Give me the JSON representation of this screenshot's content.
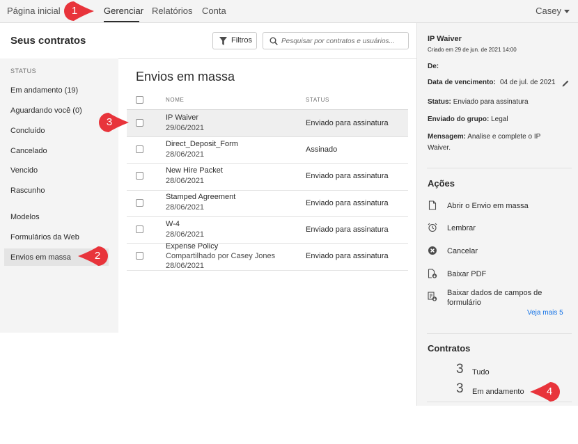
{
  "topnav": {
    "tabs": [
      "Página inicial",
      "Gerenciar",
      "Relatórios",
      "Conta"
    ],
    "active_tab": "Gerenciar",
    "user": "Casey"
  },
  "sidebar": {
    "title": "Seus contratos",
    "status_heading": "STATUS",
    "status_items": [
      "Em andamento (19)",
      "Aguardando você (0)",
      "Concluído",
      "Cancelado",
      "Vencido",
      "Rascunho"
    ],
    "other_items": [
      "Modelos",
      "Formulários da Web",
      "Envios em massa"
    ],
    "active_item": "Envios em massa"
  },
  "toolbar": {
    "filter_label": "Filtros",
    "search_placeholder": "Pesquisar por contratos e usuários..."
  },
  "main": {
    "title": "Envios em massa",
    "columns": [
      "NOME",
      "STATUS"
    ],
    "rows": [
      {
        "name": "IP Waiver",
        "sub": "",
        "date": "29/06/2021",
        "status": "Enviado para assinatura",
        "selected": true
      },
      {
        "name": "Direct_Deposit_Form",
        "sub": "",
        "date": "28/06/2021",
        "status": "Assinado",
        "selected": false
      },
      {
        "name": "New Hire Packet",
        "sub": "",
        "date": "28/06/2021",
        "status": "Enviado para assinatura",
        "selected": false
      },
      {
        "name": "Stamped Agreement",
        "sub": "",
        "date": "28/06/2021",
        "status": "Enviado para assinatura",
        "selected": false
      },
      {
        "name": "W-4",
        "sub": "",
        "date": "28/06/2021",
        "status": "Enviado para assinatura",
        "selected": false
      },
      {
        "name": "Expense Policy",
        "sub": "Compartilhado por Casey Jones",
        "date": "28/06/2021",
        "status": "Enviado para assinatura",
        "selected": false
      }
    ]
  },
  "details": {
    "title": "IP Waiver",
    "created": "Criado em 29 de jun. de 2021 14:00",
    "from_label": "De:",
    "due_label": "Data de vencimento:",
    "due_value": "04 de jul. de 2021",
    "status_label": "Status:",
    "status_value": "Enviado para assinatura",
    "group_label": "Enviado do grupo:",
    "group_value": "Legal",
    "message_label": "Mensagem:",
    "message_line1": "Analise e complete o IP",
    "message_line2": "Waiver."
  },
  "actions": {
    "title": "Ações",
    "items": [
      {
        "label": "Abrir o Envio em massa",
        "icon": "document-icon"
      },
      {
        "label": "Lembrar",
        "icon": "alarm-clock-icon"
      },
      {
        "label": "Cancelar",
        "icon": "cancel-circle-icon"
      },
      {
        "label": "Baixar PDF",
        "icon": "download-pdf-icon"
      },
      {
        "label": "Baixar dados de campos de",
        "label2": "formulário",
        "icon": "download-form-data-icon"
      }
    ],
    "more": "Veja mais 5"
  },
  "contracts": {
    "title": "Contratos",
    "items": [
      {
        "count": "3",
        "label": "Tudo"
      },
      {
        "count": "3",
        "label": "Em andamento"
      }
    ]
  },
  "callouts": [
    "1",
    "2",
    "3",
    "4"
  ],
  "colors": {
    "callout": "#e8343b",
    "link": "#1473e6",
    "panel": "#f4f4f4"
  }
}
